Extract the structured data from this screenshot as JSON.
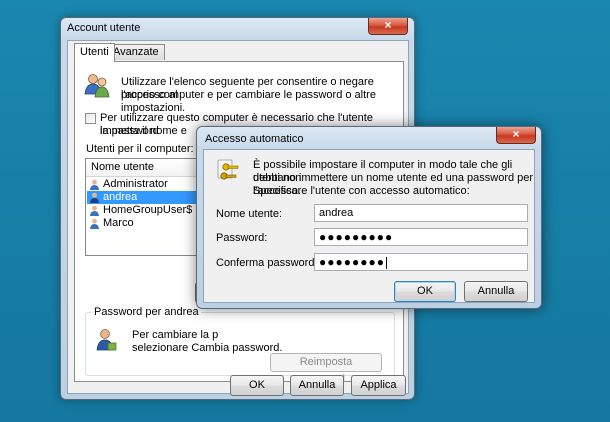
{
  "main_window": {
    "title": "Account utente",
    "close_glyph": "×",
    "tabs": [
      {
        "label": "Utenti",
        "active": true
      },
      {
        "label": "Avanzate",
        "active": false
      }
    ],
    "intro_line1": "Utilizzare l'elenco seguente per consentire o negare l'accesso al",
    "intro_line2": "proprio computer e per cambiare le password o altre impostazioni.",
    "checkbox_line1": "Per utilizzare questo computer è necessario che l'utente immetta il nome e",
    "checkbox_line2": "la password",
    "checkbox_checked": false,
    "users_label": "Utenti per il computer:",
    "list_header": "Nome utente",
    "users": [
      {
        "name": "Administrator",
        "selected": false
      },
      {
        "name": "andrea",
        "selected": true
      },
      {
        "name": "HomeGroupUser$",
        "selected": false
      },
      {
        "name": "Marco",
        "selected": false
      }
    ],
    "password_group_title": "Password per andrea",
    "password_text_line1": "Per cambiare la p",
    "password_text_line2": "selezionare Cambia password.",
    "reset_password_label": "Reimposta password...",
    "ok_label": "OK",
    "cancel_label": "Annulla",
    "apply_label": "Applica"
  },
  "auto_logon_dialog": {
    "title": "Accesso automatico",
    "close_glyph": "×",
    "desc_line1": "È possibile impostare il computer in modo tale che gli utenti non",
    "desc_line2": "debbano immettere un nome utente ed una password per l'accesso.",
    "desc_line3": "Specificare l'utente con accesso automatico:",
    "username_label": "Nome utente:",
    "username_value": "andrea",
    "password_label": "Password:",
    "password_value": "●●●●●●●●●",
    "confirm_label": "Conferma password:",
    "confirm_value": "●●●●●●●●",
    "ok_label": "OK",
    "cancel_label": "Annulla"
  },
  "colors": {
    "desktop": "#1a87b0",
    "selection": "#3399ff",
    "close_button": "#d9583f"
  }
}
